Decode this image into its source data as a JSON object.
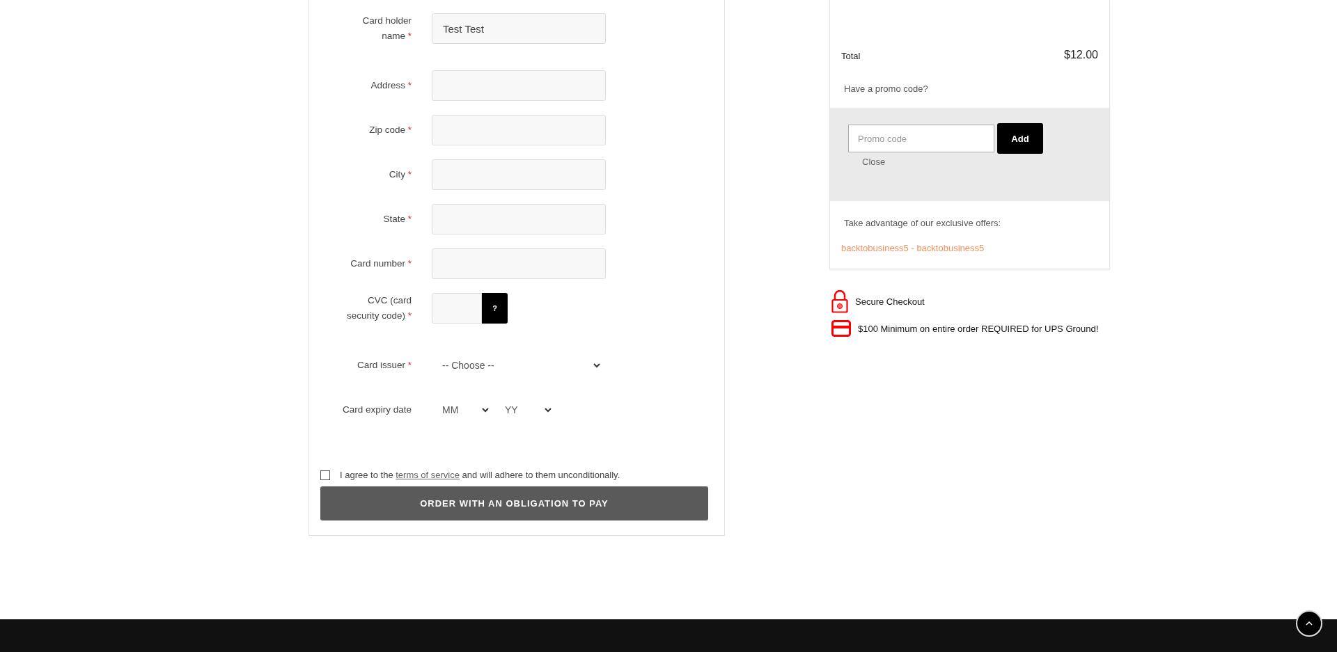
{
  "payment_form": {
    "fields": [
      {
        "kind": "text",
        "label": "Card holder name",
        "required_mark": "*",
        "value": "Test Test"
      },
      {
        "kind": "text",
        "label": "Address",
        "required_mark": "*"
      },
      {
        "kind": "text",
        "label": "Zip code",
        "required_mark": "*"
      },
      {
        "kind": "text",
        "label": "City",
        "required_mark": "*"
      },
      {
        "kind": "text",
        "label": "State",
        "required_mark": "*"
      },
      {
        "kind": "text",
        "label": "Card number",
        "required_mark": "*"
      },
      {
        "kind": "cvc",
        "label": "CVC (card security code)",
        "required_mark": "*",
        "help": "?"
      },
      {
        "kind": "select",
        "label": "Card issuer",
        "required_mark": "*",
        "value": "-- Choose --"
      },
      {
        "kind": "expiry",
        "label": "Card expiry date",
        "month": "MM",
        "year": "YY"
      }
    ],
    "terms": {
      "checked": false,
      "text_before": "I agree to the ",
      "link": "terms of service",
      "text_after": " and will adhere to them unconditionally."
    },
    "submit": "ORDER WITH AN OBLIGATION TO PAY"
  },
  "order_summary": {
    "total_label": "Total",
    "total_value": "$12.00",
    "promo_prompt": "Have a promo code?",
    "promo_placeholder": "Promo code",
    "add_button": "Add",
    "close": "Close",
    "offers_heading": "Take advantage of our exclusive offers:",
    "offer_code": "backtobusiness5 - backtobusiness5"
  },
  "notices": [
    {
      "kind": "lock",
      "text": "Secure Checkout"
    },
    {
      "kind": "card",
      "text": "$100 Minimum on entire order REQUIRED for UPS Ground!"
    }
  ]
}
